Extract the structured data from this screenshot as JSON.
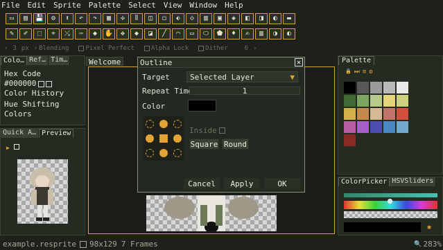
{
  "menu": [
    "File",
    "Edit",
    "Sprite",
    "Palette",
    "Select",
    "View",
    "Window",
    "Help"
  ],
  "toolbar1": [
    "▭",
    "▤",
    "💾",
    "⚙",
    "⬆",
    "↶",
    "↷",
    "▦",
    "✣",
    "⦀",
    "◫",
    "◻",
    "⬖",
    "◇",
    "▥",
    "▣",
    "◈",
    "◧",
    "◨",
    "◐",
    "▬"
  ],
  "toolbar2": [
    "✎",
    "✐",
    "⬚",
    "⌖",
    "⤯",
    "✑",
    "◆",
    "✋",
    "✥",
    "◆",
    "◪",
    "╱",
    "⌒",
    "▭",
    "⬭",
    "⬟",
    "♦",
    "✍",
    "▥",
    "◑",
    "◐"
  ],
  "options": {
    "brush_left": "‹",
    "brush_right": "›",
    "brush_size": "3",
    "unit": "px",
    "blending": "Blending",
    "pixel_perfect": "Pixel Perfect",
    "alpha_lock": "Alpha Lock",
    "dither": "Dither",
    "dither_val": "6",
    "dither_arrow": "›"
  },
  "left_tabs": [
    "Colo…",
    "Ref…",
    "Tim…"
  ],
  "left_panel": {
    "hex_label": "Hex Code",
    "hex_value": "#000000",
    "color_history": "Color History",
    "hue_shifting": "Hue Shifting Colors"
  },
  "bottom_left_tabs": [
    "Quick A…",
    "Preview"
  ],
  "canvas_tabs": [
    "Welcome"
  ],
  "dialog": {
    "title": "Outline",
    "close": "✕",
    "target_label": "Target",
    "target_value": "Selected Layer",
    "repeat_label": "Repeat Time",
    "repeat_value": "1",
    "color_label": "Color",
    "color_value": "#000000",
    "inside_label": "Inside",
    "square_label": "Square",
    "round_label": "Round",
    "cancel": "Cancel",
    "apply": "Apply",
    "ok": "OK"
  },
  "right": {
    "palette_tab": "Palette",
    "palette_icons": [
      "🔒",
      "⏭",
      "≡",
      "⚙"
    ],
    "swatches": [
      "#000000",
      "#585858",
      "#9a9a9a",
      "#b9b9b9",
      "#e8e8e8",
      "#3f6a37",
      "#7ca55f",
      "#b8c98c",
      "#e2d57a",
      "#cfd07e",
      "#d3b14a",
      "#c38a4c",
      "#d6b894",
      "#c1746a",
      "#d34f3b",
      "#b85fa4",
      "#a65fc6",
      "#4c4db0",
      "#4886c4",
      "#74a8cf",
      "#8a2a24"
    ],
    "colorpicker_tab": "ColorPicker",
    "hsv_tab": "HSVSliders"
  },
  "status": {
    "file": "example.resprite",
    "size": "98x129",
    "frames": "7 Frames",
    "zoom": "283%"
  }
}
